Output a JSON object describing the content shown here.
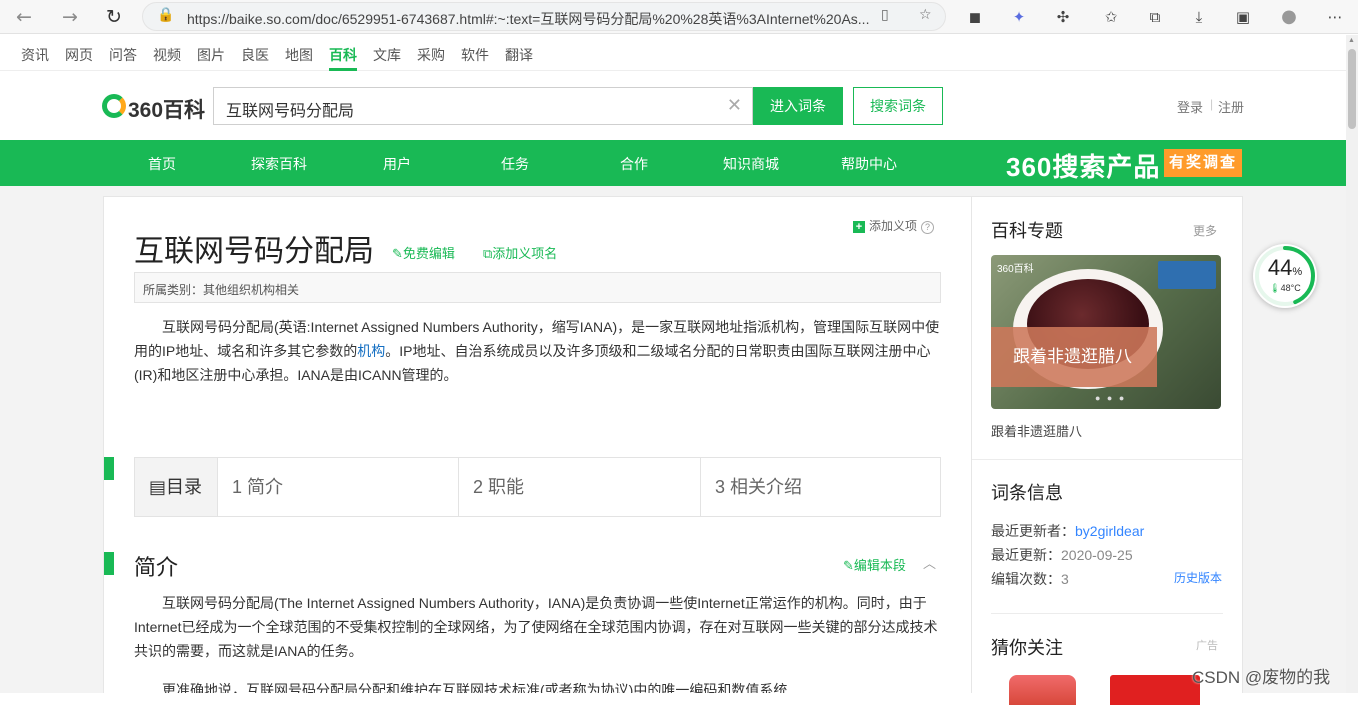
{
  "browser": {
    "url": "https://baike.so.com/doc/6529951-6743687.html#:~:text=互联网号码分配局%20%28英语%3AInternet%20As..."
  },
  "engine_tabs": [
    "资讯",
    "网页",
    "问答",
    "视频",
    "图片",
    "良医",
    "地图",
    "百科",
    "文库",
    "采购",
    "软件",
    "翻译"
  ],
  "engine_tabs_active": "百科",
  "header": {
    "logo_text": "360百科",
    "search_value": "互联网号码分配局",
    "enter_button": "进入词条",
    "search_button": "搜索词条",
    "login": "登录",
    "separator": "|",
    "register": "注册"
  },
  "nav": {
    "items": [
      "首页",
      "探索百科",
      "用户",
      "任务",
      "合作",
      "知识商城",
      "帮助中心"
    ],
    "promo": "360搜索产品",
    "promo_badge": "有奖调查"
  },
  "article": {
    "title": "互联网号码分配局",
    "edit_free": "免费编辑",
    "add_sense_name": "添加义项名",
    "add_sense": "添加义项",
    "category": "所属类别：其他组织机构相关",
    "intro_before": "互联网号码分配局(英语:Internet Assigned Numbers Authority，缩写IANA)，是一家互联网地址指派机构，管理国际互联网中使用的IP地址、域名和许多其它参数的",
    "intro_link": "机构",
    "intro_after": "。IP地址、自治系统成员以及许多顶级和二级域名分配的日常职责由国际互联网注册中心(IR)和地区注册中心承担。IANA是由ICANN管理的。",
    "toc_label": "目录",
    "toc": [
      "1 简介",
      "2 职能",
      "3 相关介绍"
    ],
    "section_title": "简介",
    "section_edit": "编辑本段",
    "section_text": "互联网号码分配局(The Internet Assigned Numbers Authority，IANA)是负责协调一些使Internet正常运作的机构。同时，由于Internet已经成为一个全球范围的不受集权控制的全球网络，为了使网络在全球范围内协调，存在对互联网一些关键的部分达成技术共识的需要，而这就是IANA的任务。",
    "section_text2": "更准确地说，互联网号码分配局分配和维护在互联网技术标准(或者称为协议)中的唯一编码和数值系统"
  },
  "sidebar": {
    "topic_heading": "百科专题",
    "more": "更多",
    "topic_image_logo": "360百科",
    "topic_banner": "跟着非遗逛腊八",
    "topic_caption": "跟着非遗逛腊八",
    "info_heading": "词条信息",
    "last_editor_label": "最近更新者：",
    "last_editor": "by2girldear",
    "last_update_label": "最近更新：",
    "last_update": "2020-09-25",
    "edit_count_label": "编辑次数：",
    "edit_count": "3",
    "history": "历史版本",
    "guess_heading": "猜你关注",
    "ad_label": "广告"
  },
  "perf_widget": {
    "value": "44",
    "unit": "%",
    "temp": "48°C",
    "level": 0.44
  },
  "watermark": "CSDN @废物的我",
  "colors": {
    "brand_green": "#19b955",
    "link_blue": "#136ec2",
    "promo_orange": "#ff9b2b"
  }
}
